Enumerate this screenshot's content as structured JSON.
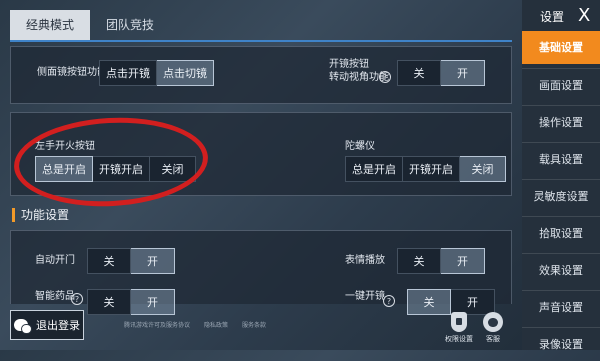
{
  "tabs": [
    {
      "label": "经典模式",
      "active": true
    },
    {
      "label": "团队竞技",
      "active": false
    }
  ],
  "panel1": {
    "side_scope": {
      "label": "侧面镜按钮功能",
      "options": [
        "点击开镜",
        "点击切镜"
      ],
      "selected": 1
    },
    "scope_button": {
      "label_line1": "开镜按钮",
      "label_line2": "转动视角功能",
      "help": "?",
      "options": [
        "关",
        "开"
      ],
      "selected": 1
    }
  },
  "panel2": {
    "left_fire": {
      "label": "左手开火按钮",
      "options": [
        "总是开启",
        "开镜开启",
        "关闭"
      ],
      "selected": 0
    },
    "gyroscope": {
      "label": "陀螺仪",
      "options": [
        "总是开启",
        "开镜开启",
        "关闭"
      ],
      "selected": 2
    }
  },
  "section": {
    "title": "功能设置"
  },
  "panel3": {
    "auto_door": {
      "label": "自动开门",
      "options": [
        "关",
        "开"
      ],
      "selected": 1
    },
    "emote": {
      "label": "表情播放",
      "options": [
        "关",
        "开"
      ],
      "selected": 1
    },
    "smart_meds": {
      "label": "智能药品",
      "help": "?",
      "options": [
        "关",
        "开"
      ],
      "selected": 1
    },
    "one_key_scope": {
      "label": "一键开镜",
      "help": "?",
      "options": [
        "关",
        "开"
      ],
      "selected": 0
    }
  },
  "sidebar": {
    "title": "设置",
    "close": "X",
    "items": [
      {
        "label": "基础设置",
        "active": true
      },
      {
        "label": "画面设置",
        "active": false
      },
      {
        "label": "操作设置",
        "active": false
      },
      {
        "label": "载具设置",
        "active": false
      },
      {
        "label": "灵敏度设置",
        "active": false
      },
      {
        "label": "拾取设置",
        "active": false
      },
      {
        "label": "效果设置",
        "active": false
      },
      {
        "label": "声音设置",
        "active": false
      },
      {
        "label": "录像设置",
        "active": false
      }
    ]
  },
  "bottom": {
    "logout_label": "退出登录",
    "links": [
      "腾讯游戏许可及服务协议",
      "隐私政策",
      "服务条款"
    ],
    "privacy_label": "权限设置",
    "service_label": "客服"
  },
  "colors": {
    "accent_orange": "#f28a1e",
    "tab_blue": "#3f83c8",
    "annotation_red": "#d21f1f"
  }
}
